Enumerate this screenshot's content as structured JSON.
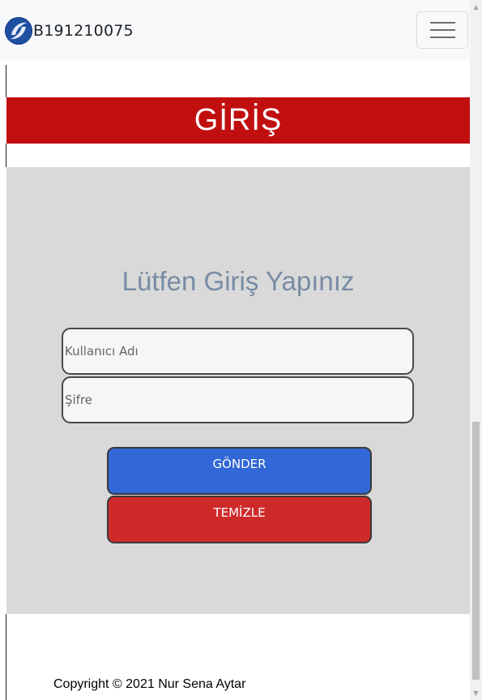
{
  "navbar": {
    "brand_text": "B191210075",
    "logo_icon": "university-logo-icon",
    "toggler_icon": "hamburger-menu-icon"
  },
  "banner": {
    "title": "GİRİŞ",
    "color": "#c10f10"
  },
  "login": {
    "heading": "Lütfen Giriş Yapınız",
    "username_placeholder": "Kullanıcı Adı",
    "password_placeholder": "Şifre",
    "submit_label": "GÖNDER",
    "clear_label": "TEMİZLE",
    "submit_color": "#3167d6",
    "clear_color": "#cf2a2a"
  },
  "footer": {
    "copyright": "Copyright © 2021 Nur Sena Aytar"
  }
}
